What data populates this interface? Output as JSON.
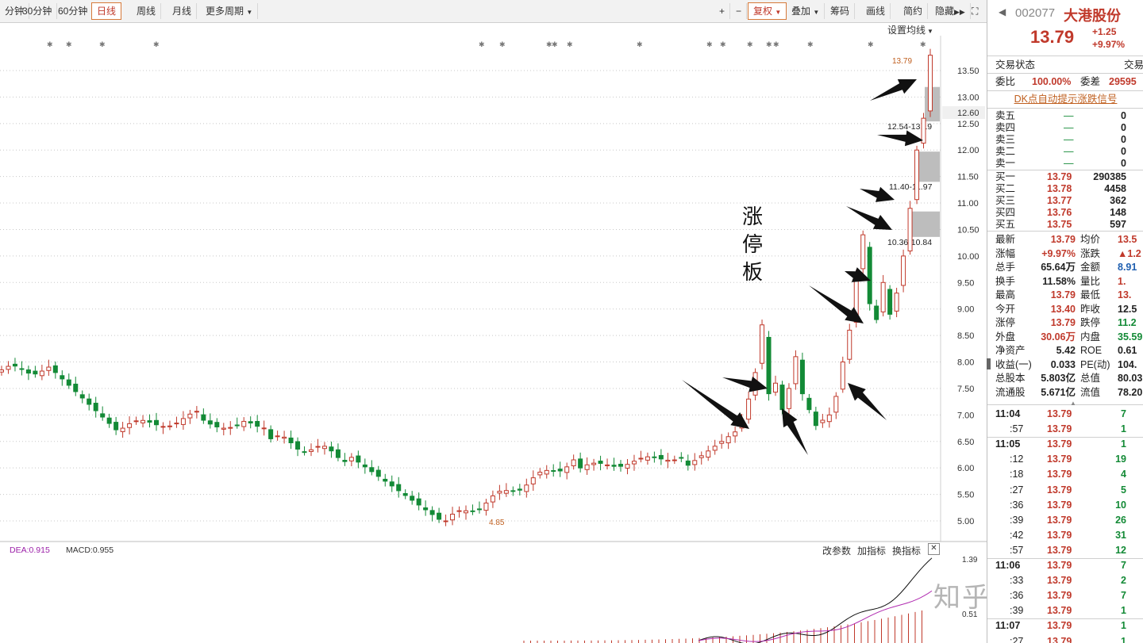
{
  "toolbar": {
    "periods": [
      "分钟",
      "30分钟",
      "60分钟",
      "日线",
      "周线",
      "月线",
      "更多周期"
    ],
    "active_period": "日线",
    "right_buttons": [
      "+",
      "−",
      "复权",
      "叠加",
      "筹码",
      "画线",
      "简约",
      "隐藏"
    ]
  },
  "chart": {
    "ma_settings": "设置均线",
    "price_axis": [
      "13.50",
      "13.00",
      "12.50",
      "12.00",
      "11.50",
      "11.00",
      "10.50",
      "10.00",
      "9.50",
      "9.00",
      "8.50",
      "8.00",
      "7.50",
      "7.00",
      "6.50",
      "6.00",
      "5.50",
      "5.00"
    ],
    "current_price_label": "12.60",
    "high_label": "13.79",
    "low_label": "4.85",
    "gap_labels": [
      "12.54-13.19",
      "11.40-11.97",
      "10.36-10.84"
    ],
    "annotation": [
      "涨",
      "停",
      "板"
    ]
  },
  "indicator": {
    "dea_label": "DEA:0.915",
    "macd_label": "MACD:0.955",
    "buttons": [
      "改参数",
      "加指标",
      "换指标"
    ],
    "axis": [
      "1.39",
      "0.51"
    ]
  },
  "watermark": "知乎 @归仪",
  "quote": {
    "code": "002077",
    "name": "大港股份",
    "price": "13.79",
    "change": "+1.25",
    "change_pct": "+9.97%",
    "trade_status": "交易状态",
    "trade_status_right": "交易",
    "weibi_label": "委比",
    "weibi": "100.00%",
    "weicha_label": "委差",
    "weicha": "29595",
    "dk_link": "DK点自动提示涨跌信号",
    "sells": [
      {
        "label": "卖五",
        "price": "—",
        "vol": "0"
      },
      {
        "label": "卖四",
        "price": "—",
        "vol": "0"
      },
      {
        "label": "卖三",
        "price": "—",
        "vol": "0"
      },
      {
        "label": "卖二",
        "price": "—",
        "vol": "0"
      },
      {
        "label": "卖一",
        "price": "—",
        "vol": "0"
      }
    ],
    "buys": [
      {
        "label": "买一",
        "price": "13.79",
        "vol": "290385"
      },
      {
        "label": "买二",
        "price": "13.78",
        "vol": "4458"
      },
      {
        "label": "买三",
        "price": "13.77",
        "vol": "362"
      },
      {
        "label": "买四",
        "price": "13.76",
        "vol": "148"
      },
      {
        "label": "买五",
        "price": "13.75",
        "vol": "597"
      }
    ],
    "stats": [
      {
        "l1": "最新",
        "v1": "13.79",
        "c1": "red",
        "l2": "均价",
        "v2": "13.5",
        "c2": "red"
      },
      {
        "l1": "涨幅",
        "v1": "+9.97%",
        "c1": "red",
        "l2": "涨跌",
        "v2": "▲1.2",
        "c2": "red"
      },
      {
        "l1": "总手",
        "v1": "65.64万",
        "c1": "",
        "l2": "金额",
        "v2": "8.91",
        "c2": "blue"
      },
      {
        "l1": "换手",
        "v1": "11.58%",
        "c1": "",
        "l2": "量比",
        "v2": "1.",
        "c2": "red"
      },
      {
        "l1": "最高",
        "v1": "13.79",
        "c1": "red",
        "l2": "最低",
        "v2": "13.",
        "c2": "red"
      },
      {
        "l1": "今开",
        "v1": "13.40",
        "c1": "red",
        "l2": "昨收",
        "v2": "12.5",
        "c2": ""
      },
      {
        "l1": "涨停",
        "v1": "13.79",
        "c1": "red",
        "l2": "跌停",
        "v2": "11.2",
        "c2": "green"
      },
      {
        "l1": "外盘",
        "v1": "30.06万",
        "c1": "red",
        "l2": "内盘",
        "v2": "35.59",
        "c2": "green"
      },
      {
        "l1": "净资产",
        "v1": "5.42",
        "c1": "",
        "l2": "ROE",
        "v2": "0.61",
        "c2": ""
      },
      {
        "l1": "收益(一)",
        "v1": "0.033",
        "c1": "",
        "l2": "PE(动)",
        "v2": "104.",
        "c2": ""
      },
      {
        "l1": "总股本",
        "v1": "5.803亿",
        "c1": "",
        "l2": "总值",
        "v2": "80.03",
        "c2": ""
      },
      {
        "l1": "流通股",
        "v1": "5.671亿",
        "c1": "",
        "l2": "流值",
        "v2": "78.20",
        "c2": ""
      }
    ],
    "ticks": [
      {
        "t": "11:04",
        "p": "13.79",
        "v": "7"
      },
      {
        "t": ":57",
        "p": "13.79",
        "v": "1"
      },
      {
        "t": "11:05",
        "p": "13.79",
        "v": "1"
      },
      {
        "t": ":12",
        "p": "13.79",
        "v": "19"
      },
      {
        "t": ":18",
        "p": "13.79",
        "v": "4"
      },
      {
        "t": ":27",
        "p": "13.79",
        "v": "5"
      },
      {
        "t": ":36",
        "p": "13.79",
        "v": "10"
      },
      {
        "t": ":39",
        "p": "13.79",
        "v": "26"
      },
      {
        "t": ":42",
        "p": "13.79",
        "v": "31"
      },
      {
        "t": ":57",
        "p": "13.79",
        "v": "12"
      },
      {
        "t": "11:06",
        "p": "13.79",
        "v": "7"
      },
      {
        "t": ":33",
        "p": "13.79",
        "v": "2"
      },
      {
        "t": ":36",
        "p": "13.79",
        "v": "7"
      },
      {
        "t": ":39",
        "p": "13.79",
        "v": "1"
      },
      {
        "t": "11:07",
        "p": "13.79",
        "v": "1"
      },
      {
        "t": ":27",
        "p": "13.79",
        "v": "1"
      }
    ]
  },
  "colors": {
    "up": "#c0392b",
    "down": "#138a36",
    "grid": "#c8c8c8"
  }
}
